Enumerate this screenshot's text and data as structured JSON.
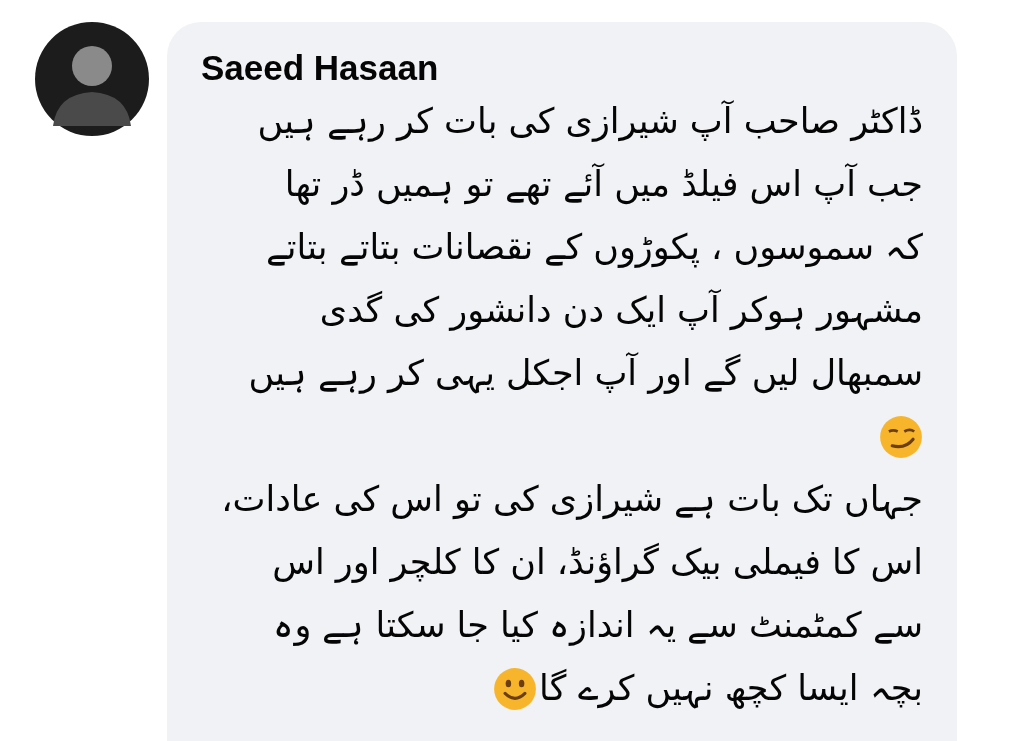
{
  "comment": {
    "author": "Saeed Hasaan",
    "lines": [
      {
        "kind": "text",
        "text": "ڈاکٹر صاحب آپ شیرازی کی بات کر رہے ہیں"
      },
      {
        "kind": "text",
        "text": "جب آپ اس فیلڈ میں آئے تھے تو ہمیں ڈر تھا"
      },
      {
        "kind": "text",
        "text": "کہ سموسوں ، پکوڑوں کے نقصانات بتاتے بتاتے"
      },
      {
        "kind": "text",
        "text": "مشہور ہوکر آپ ایک دن دانشور کی گدی"
      },
      {
        "kind": "text",
        "text": "سمبھال لیں گے اور آپ اجکل یہی کر رہے ہیں"
      },
      {
        "kind": "smirk"
      },
      {
        "kind": "text",
        "text": "جہاں تک بات ہے شیرازی کی تو اس کی عادات،"
      },
      {
        "kind": "text",
        "text": "اس کا فیملی بیک گراؤنڈ، ان کا کلچر اور اس"
      },
      {
        "kind": "text",
        "text": "سے کمٹمنٹ سے یہ اندازہ کیا جا سکتا ہے وہ"
      },
      {
        "kind": "smile",
        "text": "بچہ ایسا کچھ نہیں کرے گا"
      }
    ]
  }
}
